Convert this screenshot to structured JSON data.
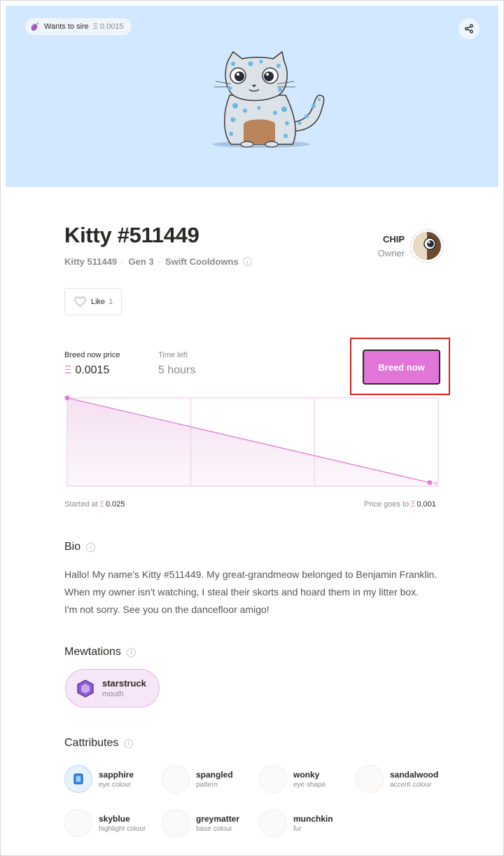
{
  "hero": {
    "sire_badge_label": "Wants to sire",
    "sire_badge_price": "Ξ 0.0015",
    "background_color": "#d2e8fe"
  },
  "kitty": {
    "title": "Kitty #511449",
    "subtitle": [
      "Kitty 511449",
      "Gen 3",
      "Swift Cooldowns"
    ]
  },
  "owner": {
    "name": "CHIP",
    "role": "Owner"
  },
  "like": {
    "label": "Like",
    "count": "1"
  },
  "breed": {
    "price_label": "Breed now price",
    "price_value": "0.0015",
    "time_label": "Time left",
    "time_value": "5 hours",
    "button_label": "Breed now",
    "button_color": "#e176d8",
    "currency_symbol": "Ξ"
  },
  "chart_data": {
    "type": "line",
    "start_label": "Started at",
    "start_price": 0.025,
    "end_label": "Price goes to",
    "end_price": 0.001,
    "start_text": "0.025",
    "end_text": "0.001",
    "segments": 3,
    "line_color": "#e07ad4"
  },
  "bio": {
    "heading": "Bio",
    "lines": [
      "Hallo! My name's Kitty #511449. My great-grandmeow belonged to Benjamin Franklin.",
      "When my owner isn't watching, I steal their skorts and hoard them in my litter box.",
      "I'm not sorry. See you on the dancefloor amigo!"
    ]
  },
  "mewtations": {
    "heading": "Mewtations",
    "items": [
      {
        "name": "starstruck",
        "type": "mouth"
      }
    ]
  },
  "cattributes": {
    "heading": "Cattributes",
    "items": [
      {
        "name": "sapphire",
        "type": "eye colour"
      },
      {
        "name": "spangled",
        "type": "pattern"
      },
      {
        "name": "wonky",
        "type": "eye shape"
      },
      {
        "name": "sandalwood",
        "type": "accent colour"
      },
      {
        "name": "skyblue",
        "type": "highlight colour"
      },
      {
        "name": "greymatter",
        "type": "base colour"
      },
      {
        "name": "munchkin",
        "type": "fur"
      }
    ]
  },
  "icons": {
    "eggplant": "eggplant-icon",
    "share": "share-icon",
    "heart": "heart-icon",
    "info": "info-icon",
    "gem": "gem-icon"
  }
}
